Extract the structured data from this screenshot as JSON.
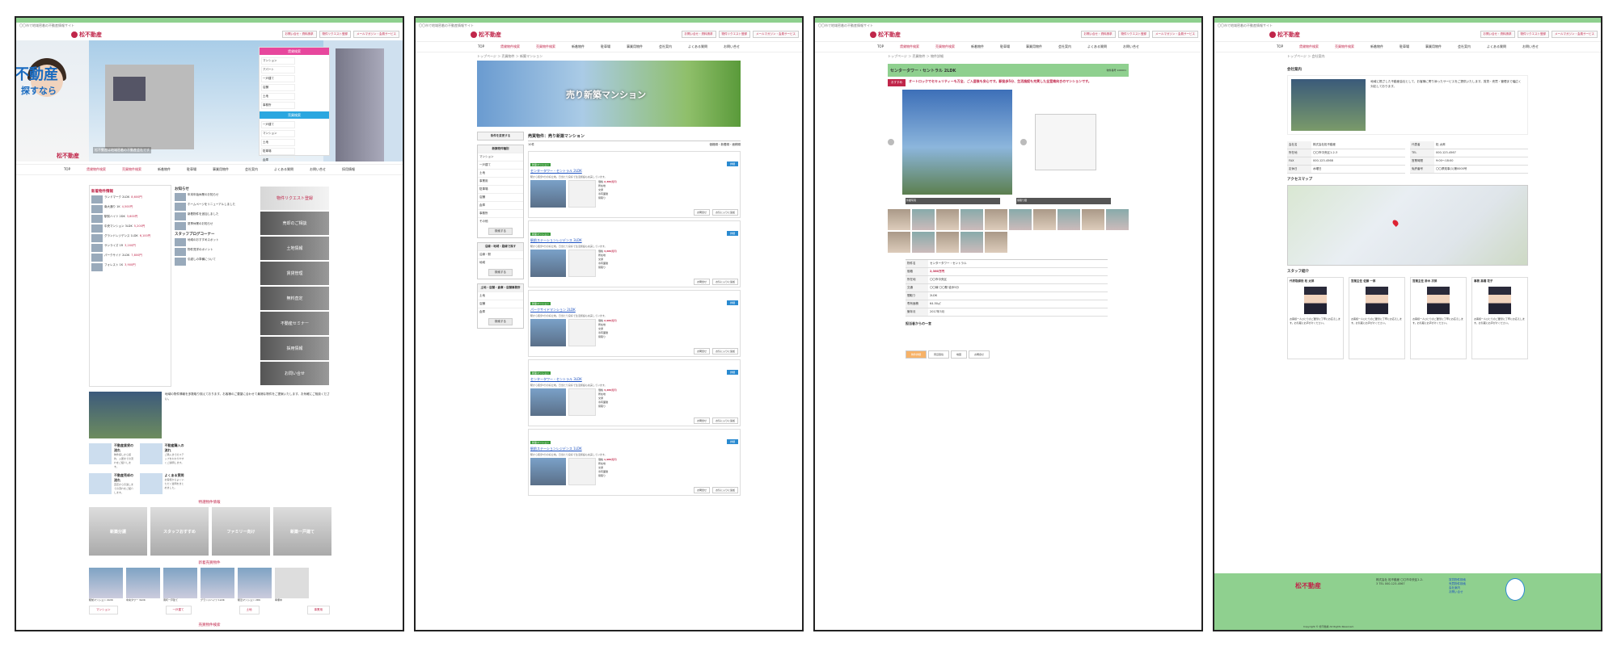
{
  "site": {
    "tagline": "〇〇市で地域密着の不動産情報サイト",
    "logo_text": "松不動産",
    "header_links": [
      "お問い合せ・資料請求",
      "物件リクエスト登録",
      "メールマガジン・会員サービス"
    ],
    "nav": [
      "TOP",
      "賃貸物件検索",
      "売買物件検索",
      "新着物件",
      "駐車場",
      "事業用物件",
      "会社案内",
      "よくある質問",
      "お問い合せ",
      "採用情報"
    ]
  },
  "p1": {
    "hero_brand": "不動産",
    "hero_brand2": "探すなら",
    "hero_catch": "松不動産は地域密着の不動産会社です",
    "search_head_rent": "賃貸検索",
    "search_head_sale": "売買検索",
    "search_items": [
      "マンション",
      "アパート",
      "一戸建て",
      "店舗",
      "土地",
      "事務所",
      "駐車場",
      "倉庫"
    ],
    "new_title": "新着物件情報",
    "new_items": [
      {
        "t": "ランドマーク 2LDK",
        "p": "8,600円"
      },
      {
        "t": "南大通り 1K",
        "p": "4,500円"
      },
      {
        "t": "駅前ハイツ 2DK",
        "p": "3,600円"
      },
      {
        "t": "中央マンション 3LDK",
        "p": "5,200円"
      },
      {
        "t": "グランドレジデンス 1LDK",
        "p": "6,100円"
      },
      {
        "t": "サンライズ 1R",
        "p": "3,200円"
      },
      {
        "t": "パークサイド 2LDK",
        "p": "7,800円"
      },
      {
        "t": "フォレスト 1K",
        "p": "3,900円"
      }
    ],
    "news_title": "お知らせ",
    "news_items": [
      "年末年始休業のお知らせ",
      "ホームページをリニューアルしました",
      "新着物件を追加しました",
      "夏季休業のお知らせ"
    ],
    "blog_title": "スタッフブログコーナー",
    "blog_items": [
      "地域のおすすめスポット",
      "物件見学のポイント",
      "引越しの準備について"
    ],
    "banners": [
      "物件リクエスト登録",
      "売却のご相談",
      "土地情報",
      "賃貸管理",
      "無料査定",
      "不動産セミナー",
      "採用情報",
      "お問い合せ"
    ],
    "intro_text": "地域の物件情報を多数取り揃えております。お客様のご要望に合わせて最適な物件をご提案いたします。お気軽にご相談ください。",
    "flows": [
      {
        "t": "不動産賃貸の流れ",
        "d": "物件探しから契約、入居までの流れをご紹介します。"
      },
      {
        "t": "不動産購入の流れ",
        "d": "ご購入までのステップをわかりやすくご説明します。"
      },
      {
        "t": "不動産売却の流れ",
        "d": "査定から引渡しまでの流れをご紹介します。"
      },
      {
        "t": "よくある質問",
        "d": "お客様からよくいただく質問をまとめました。"
      }
    ],
    "featured_title": "特選物件情報",
    "promo": [
      "新築分譲",
      "スタッフおすすめ",
      "ファミリー向け",
      "新築一戸建て"
    ],
    "latest_title": "新着売買物件",
    "latest": [
      "駅前マンション 2LDK",
      "中央タワー 3LDK",
      "南町一戸建て",
      "グランドハイツ 1LDK",
      "駅近マンション 2DK",
      "準備中"
    ],
    "buttons": [
      "マンション",
      "一戸建て",
      "土地",
      "事業用",
      "分譲物件一覧",
      "売買物件一覧"
    ],
    "footer_link": "売買物件検索"
  },
  "p2": {
    "crumb": "トップページ ＞ 売買物件 ＞ 新築マンション",
    "banner": "売り新築マンション",
    "side_boxes": [
      {
        "t": "条件を変更する",
        "items": []
      },
      {
        "t": "新築物件種別",
        "items": [
          "マンション",
          "一戸建て",
          "土地",
          "事業用",
          "駐車場",
          "店舗",
          "倉庫",
          "事務所",
          "その他"
        ],
        "btn": "検索する"
      },
      {
        "t": "沿線・地域・路線で探す",
        "items": [
          "沿線・駅",
          "地域"
        ],
        "btn": "検索する"
      },
      {
        "t": "土地・店舗・倉庫・店舗事務所",
        "items": [
          "土地",
          "店舗",
          "倉庫"
        ],
        "btn": "検索する"
      }
    ],
    "list_title": "売買物件：売り新築マンション",
    "count": "10件",
    "sort": "価格順・新着順・面積順",
    "cards": [
      {
        "tag": "新築マンション",
        "name": "センタータワー・セントラル 2LDK",
        "price": "2,380万円",
        "detail": "詳細"
      },
      {
        "tag": "新築マンション",
        "name": "駅前ステーションレジデンス 3LDK",
        "price": "3,680万円",
        "detail": "詳細"
      },
      {
        "tag": "新築マンション",
        "name": "パークサイドマンション 2LDK",
        "price": "2,980万円",
        "detail": "詳細"
      },
      {
        "tag": "新築マンション",
        "name": "センタータワー・セントラル 3LDK",
        "price": "3,280万円",
        "detail": "詳細"
      },
      {
        "tag": "新築マンション",
        "name": "駅前ステーションレジデンス 1LDK",
        "price": "1,980万円",
        "detail": "詳細"
      }
    ],
    "card_desc": "駅から徒歩5分の好立地。日当たり良好で生活施設も充実しています。",
    "spec_labels": [
      "価格",
      "所在地",
      "交通",
      "専有面積",
      "間取り",
      "築年月"
    ],
    "card_btns": [
      "お問合せ",
      "お気に入りに追加"
    ]
  },
  "p3": {
    "crumb": "トップページ ＞ 売買物件 ＞ 物件詳細",
    "title": "センタータワー・セントラル 2LDK",
    "title_sub": "物件番号 100001",
    "rec_badge": "おすすめ",
    "rec_text": "オートロックでセキュリティーも万全、ご入居後も安心です。駅徒歩5分、生活施設も充実した全室南向きのマンションです。",
    "captions": [
      "外観写真",
      "間取り図"
    ],
    "table": [
      {
        "th": "物件名",
        "td": "センタータワー・セントラル"
      },
      {
        "th": "価格",
        "td": "2,380万円",
        "hot": true
      },
      {
        "th": "所在地",
        "td": "〇〇市中央区"
      },
      {
        "th": "交通",
        "td": "〇〇線 〇〇駅 徒歩5分"
      },
      {
        "th": "間取り",
        "td": "2LDK"
      },
      {
        "th": "専有面積",
        "td": "64.50㎡"
      },
      {
        "th": "築年月",
        "td": "2017年3月"
      }
    ],
    "staff_title": "担当者からの一言",
    "tabs": [
      "物件詳細",
      "周辺環境",
      "地図",
      "お問合せ"
    ]
  },
  "p4": {
    "crumb": "トップページ ＞ 会社案内",
    "intro_title": "会社案内",
    "intro_text": "地域に根ざした不動産会社として、お客様に寄り添ったサービスをご提供いたします。賃貸・売買・管理まで幅広く対応しております。",
    "company": [
      {
        "th": "会社名",
        "td": "株式会社松不動産"
      },
      {
        "th": "代表者",
        "td": "松 太郎"
      },
      {
        "th": "所在地",
        "td": "〇〇市中央区1-2-3"
      },
      {
        "th": "TEL",
        "td": "000-123-4567"
      },
      {
        "th": "FAX",
        "td": "000-123-4568"
      },
      {
        "th": "営業時間",
        "td": "9:00〜18:00"
      },
      {
        "th": "定休日",
        "td": "水曜日"
      },
      {
        "th": "免許番号",
        "td": "〇〇県知事(1)第0000号"
      }
    ],
    "map_title": "アクセスマップ",
    "staff_title": "スタッフ紹介",
    "staff": [
      {
        "role": "代表取締役",
        "name": "松 太郎"
      },
      {
        "role": "営業主任",
        "name": "佐藤 一郎"
      },
      {
        "role": "営業主任",
        "name": "鈴木 次郎"
      },
      {
        "role": "事務",
        "name": "高橋 花子"
      }
    ],
    "staff_desc": "お客様一人ひとりのご要望に丁寧にお応えします。お気軽にお声がけください。",
    "footer_logo": "松不動産",
    "footer_addr": "株式会社 松不動産 〇〇市中央区1-2-3 TEL 000-123-4567",
    "footer_links": [
      "賃貸物件検索",
      "売買物件検索",
      "会社案内",
      "お問い合せ"
    ],
    "copyright": "Copyright © 松不動産 All Rights Reserved."
  }
}
